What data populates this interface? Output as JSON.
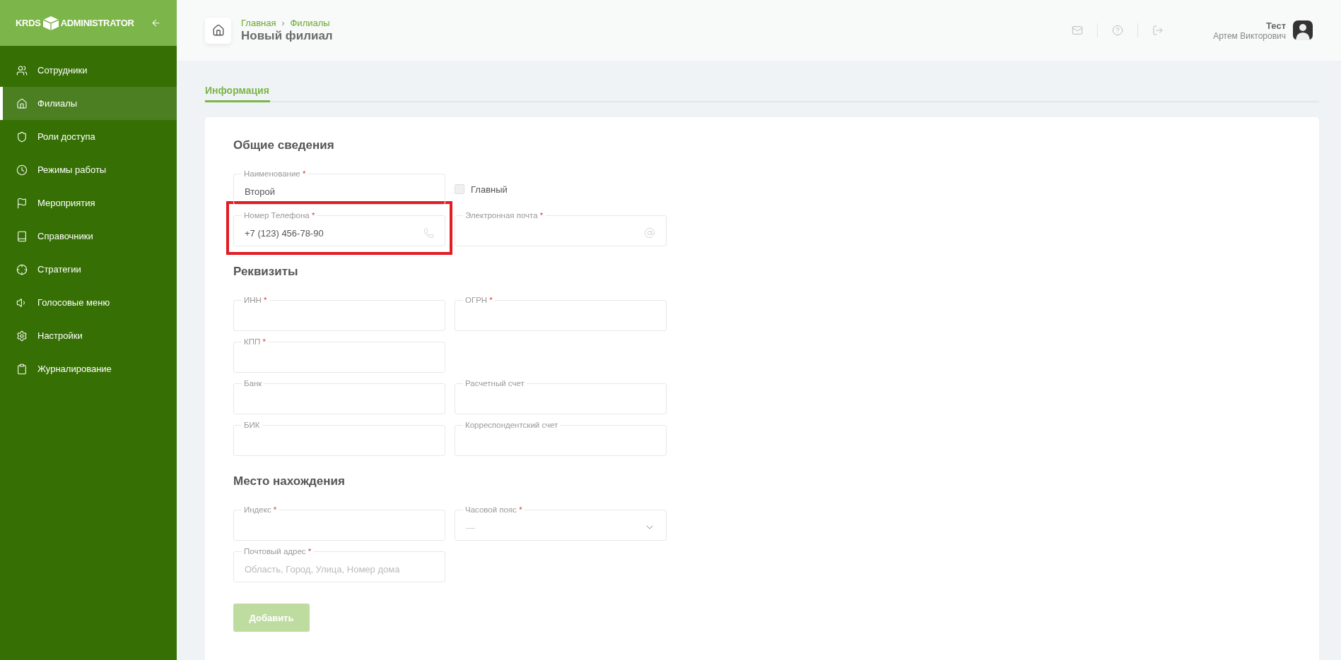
{
  "sidebar": {
    "logo": {
      "left": "KRDS",
      "right": "ADMINISTRATOR"
    },
    "items": [
      {
        "label": "Сотрудники",
        "selected": false
      },
      {
        "label": "Филиалы",
        "selected": true
      },
      {
        "label": "Роли доступа",
        "selected": false
      },
      {
        "label": "Режимы работы",
        "selected": false
      },
      {
        "label": "Мероприятия",
        "selected": false
      },
      {
        "label": "Справочники",
        "selected": false
      },
      {
        "label": "Стратегии",
        "selected": false
      },
      {
        "label": "Голосовые меню",
        "selected": false
      },
      {
        "label": "Настройки",
        "selected": false
      },
      {
        "label": "Журналирование",
        "selected": false
      }
    ]
  },
  "header": {
    "breadcrumbs": [
      "Главная",
      "Филиалы"
    ],
    "separator": "›",
    "title": "Новый филиал",
    "user": {
      "name": "Тест",
      "subtitle": "Артем Викторович"
    }
  },
  "tabs": [
    {
      "label": "Информация",
      "selected": true
    }
  ],
  "sections": [
    {
      "title": "Общие сведения",
      "rows": [
        [
          {
            "kind": "text",
            "label": "Наименование",
            "mark": "*",
            "value": "Второй"
          },
          {
            "kind": "checkbox",
            "label": "Главный",
            "checked": false
          }
        ],
        [
          {
            "kind": "phone",
            "label": "Номер Телефона",
            "mark": "*",
            "value": "+7 (123) 456-78-90",
            "highlighted": true
          },
          {
            "kind": "email",
            "label": "Электронная почта",
            "mark": "*"
          }
        ]
      ]
    },
    {
      "title": "Реквизиты",
      "rows": [
        [
          {
            "kind": "text",
            "label": "ИНН",
            "mark": "*"
          },
          {
            "kind": "text",
            "label": "ОГРН",
            "mark": "*"
          }
        ],
        [
          {
            "kind": "text",
            "label": "КПП",
            "mark": "*"
          }
        ],
        [
          {
            "kind": "text",
            "label": "Банк"
          },
          {
            "kind": "text",
            "label": "Расчетный счет"
          }
        ],
        [
          {
            "kind": "text",
            "label": "БИК"
          },
          {
            "kind": "text",
            "label": "Корреспондентский счет"
          }
        ]
      ]
    },
    {
      "title": "Место нахождения",
      "rows": [
        [
          {
            "kind": "text",
            "label": "Индекс",
            "mark": "*"
          },
          {
            "kind": "select",
            "label": "Часовой пояс",
            "mark": "*",
            "placeholder": "—"
          }
        ],
        [
          {
            "kind": "text",
            "label": "Почтовый адрес",
            "mark": "*",
            "placeholder": "Область, Город, Улица, Номер дома"
          }
        ]
      ]
    }
  ],
  "submit": {
    "label": "Добавить",
    "disabled": true
  }
}
